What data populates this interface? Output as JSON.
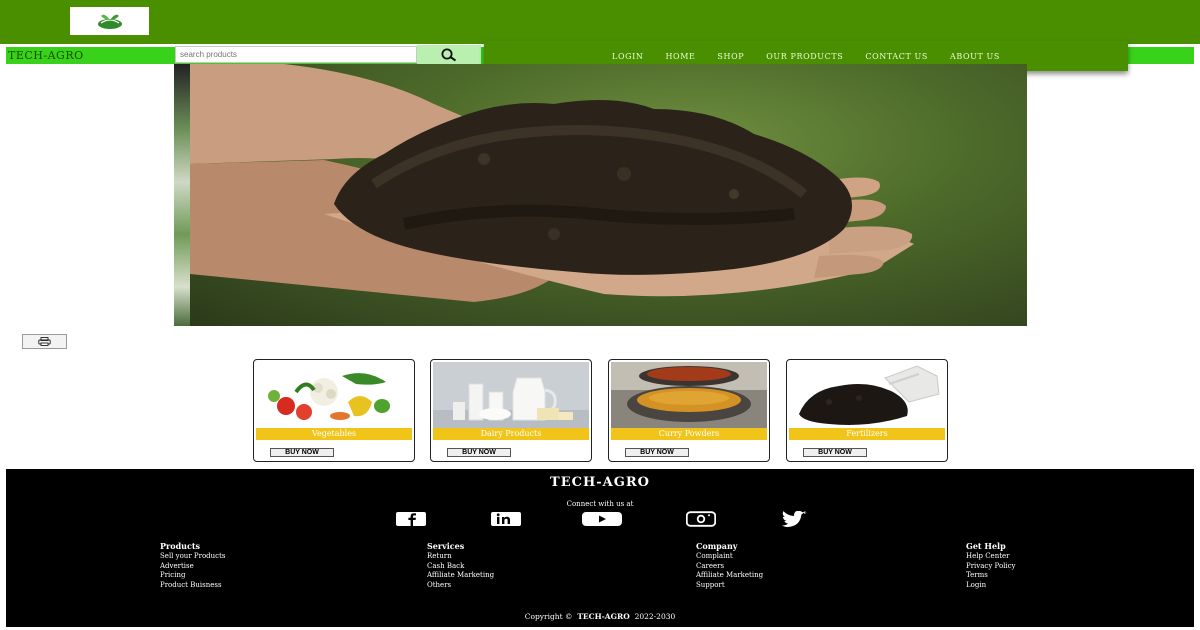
{
  "header": {
    "brand": "TECH-AGRO",
    "colors": {
      "primary_green": "#4a8f00",
      "bright_green": "#39d21b",
      "card_label_yellow": "#f0c419"
    }
  },
  "search": {
    "placeholder": "search products",
    "button_icon": "search-icon"
  },
  "nav": {
    "items": [
      "LOGIN",
      "HOME",
      "SHOP",
      "OUR PRODUCTS",
      "CONTACT US",
      "ABOUT US"
    ]
  },
  "print_button_icon": "print-icon",
  "products": [
    {
      "label": "Vegetables",
      "button": "BUY NOW",
      "image": "vegetables-image"
    },
    {
      "label": "Dairy Products",
      "button": "BUY NOW",
      "image": "dairy-products-image"
    },
    {
      "label": "Curry Powders",
      "button": "BUY NOW",
      "image": "curry-powders-image"
    },
    {
      "label": "Fertilizers",
      "button": "BUY NOW",
      "image": "fertilizers-image"
    }
  ],
  "footer": {
    "title": "TECH-AGRO",
    "connect_text": "Connect with us at",
    "social_icons": [
      "facebook-icon",
      "linkedin-icon",
      "youtube-icon",
      "instagram-icon",
      "twitter-icon"
    ],
    "columns": [
      {
        "heading": "Products",
        "links": [
          "Sell your Products",
          "Advertise",
          "Pricing",
          "Product Buisness"
        ]
      },
      {
        "heading": "Services",
        "links": [
          "Return",
          "Cash Back",
          "Affiliate Marketing",
          "Others"
        ]
      },
      {
        "heading": "Company",
        "links": [
          "Complaint",
          "Careers",
          "Affiliate Marketing",
          "Support"
        ]
      },
      {
        "heading": "Get Help",
        "links": [
          "Help Center",
          "Privacy Policy",
          "Terms",
          "Login"
        ]
      }
    ],
    "copyright_prefix": "Copyright ©",
    "copyright_brand": "TECH-AGRO",
    "copyright_years": "2022-2030"
  }
}
